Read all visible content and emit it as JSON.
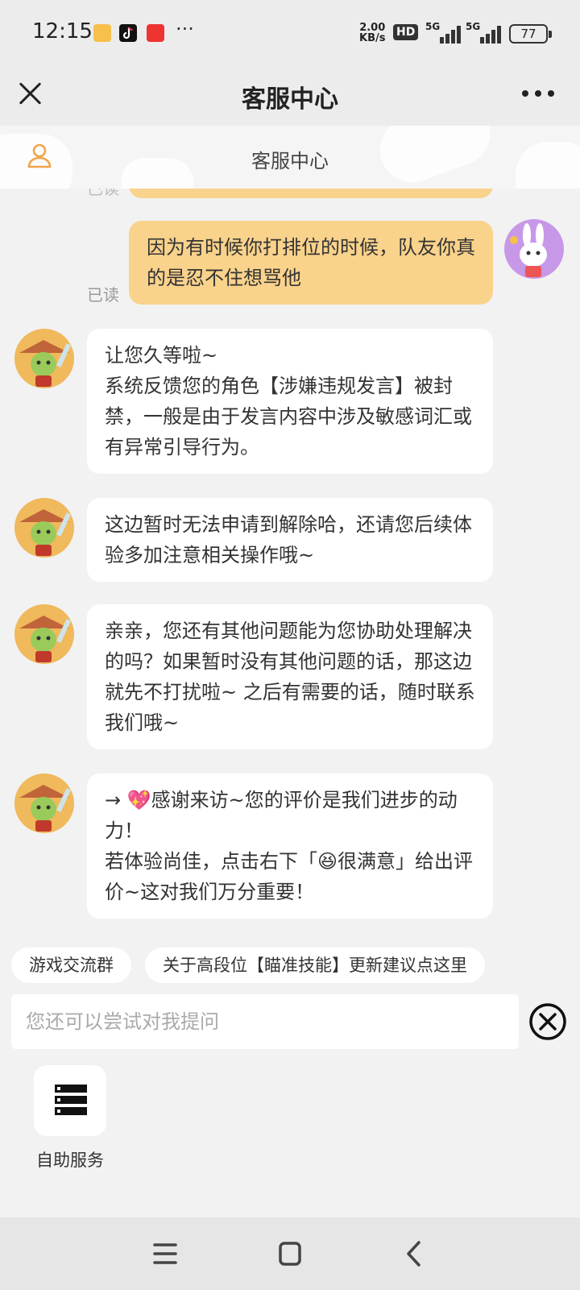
{
  "status_bar": {
    "time": "12:15",
    "more_notifications": "···",
    "net_speed_value": "2.00",
    "net_speed_unit": "KB/s",
    "hd_badge": "HD",
    "sim1_label": "5G",
    "sim2_label": "5G",
    "battery": "77"
  },
  "title_bar": {
    "title": "客服中心"
  },
  "subheader": {
    "title": "客服中心"
  },
  "chat": {
    "user_messages": [
      {
        "text": "因为有时候你打排位的时候，队友你真的是忍不住想骂他",
        "read_label": "已读"
      }
    ],
    "agent_messages": [
      {
        "text": "让您久等啦~\n系统反馈您的角色【涉嫌违规发言】被封禁，一般是由于发言内容中涉及敏感词汇或有异常引导行为。"
      },
      {
        "text": "这边暂时无法申请到解除哈，还请您后续体验多加注意相关操作哦~"
      },
      {
        "text": "亲亲，您还有其他问题能为您协助处理解决的吗？如果暂时没有其他问题的话，那这边就先不打扰啦~ 之后有需要的话，随时联系我们哦~"
      },
      {
        "text": "→ 💖感谢来访~您的评价是我们进步的动力！\n若体验尚佳，点击右下「😆很满意」给出评价~这对我们万分重要！"
      }
    ]
  },
  "quick_replies": [
    {
      "label": "游戏交流群"
    },
    {
      "label": "关于高段位【瞄准技能】更新建议点这里"
    }
  ],
  "input": {
    "placeholder": "您还可以尝试对我提问"
  },
  "tools": [
    {
      "label": "自助服务",
      "icon": "server-icon"
    }
  ],
  "colors": {
    "user_bubble": "#f9d28b",
    "agent_bubble": "#ffffff",
    "accent": "#f0a44a"
  }
}
